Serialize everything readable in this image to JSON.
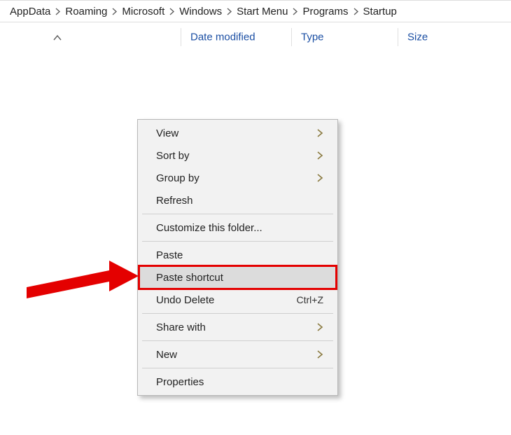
{
  "breadcrumb": {
    "items": [
      "AppData",
      "Roaming",
      "Microsoft",
      "Windows",
      "Start Menu",
      "Programs",
      "Startup"
    ]
  },
  "columns": {
    "name": "",
    "date": "Date modified",
    "type": "Type",
    "size": "Size"
  },
  "context_menu": {
    "view": "View",
    "sort_by": "Sort by",
    "group_by": "Group by",
    "refresh": "Refresh",
    "customize": "Customize this folder...",
    "paste": "Paste",
    "paste_shortcut": "Paste shortcut",
    "undo_delete": "Undo Delete",
    "undo_delete_shortcut": "Ctrl+Z",
    "share_with": "Share with",
    "new": "New",
    "properties": "Properties"
  }
}
